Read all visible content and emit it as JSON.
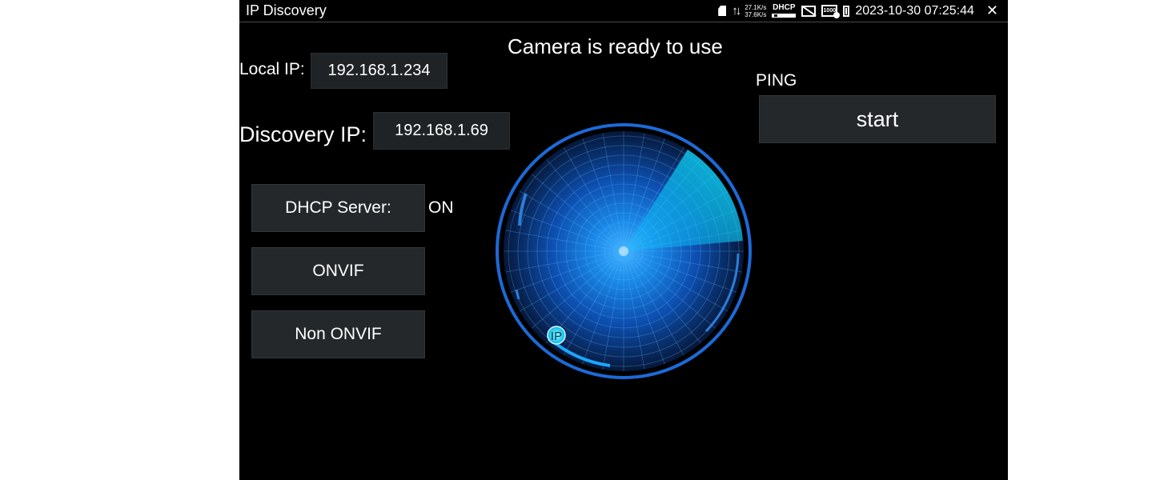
{
  "status_bar": {
    "app_title": "IP Discovery",
    "speed_up": "27.1K/s",
    "speed_down": "37.6K/s",
    "dhcp_label": "DHCP",
    "poe_label": "1000",
    "datetime": "2023-10-30 07:25:44"
  },
  "headline": "Camera is ready to use",
  "local_ip": {
    "label": "Local IP:",
    "value": "192.168.1.234"
  },
  "discovery_ip": {
    "label": "Discovery IP:",
    "value": "192.168.1.69"
  },
  "dhcp_server": {
    "button_label": "DHCP Server:",
    "state": "ON"
  },
  "onvif_button": "ONVIF",
  "non_onvif_button": "Non ONVIF",
  "ping": {
    "label": "PING",
    "start_button": "start"
  },
  "radar": {
    "marker_label": "IP"
  }
}
